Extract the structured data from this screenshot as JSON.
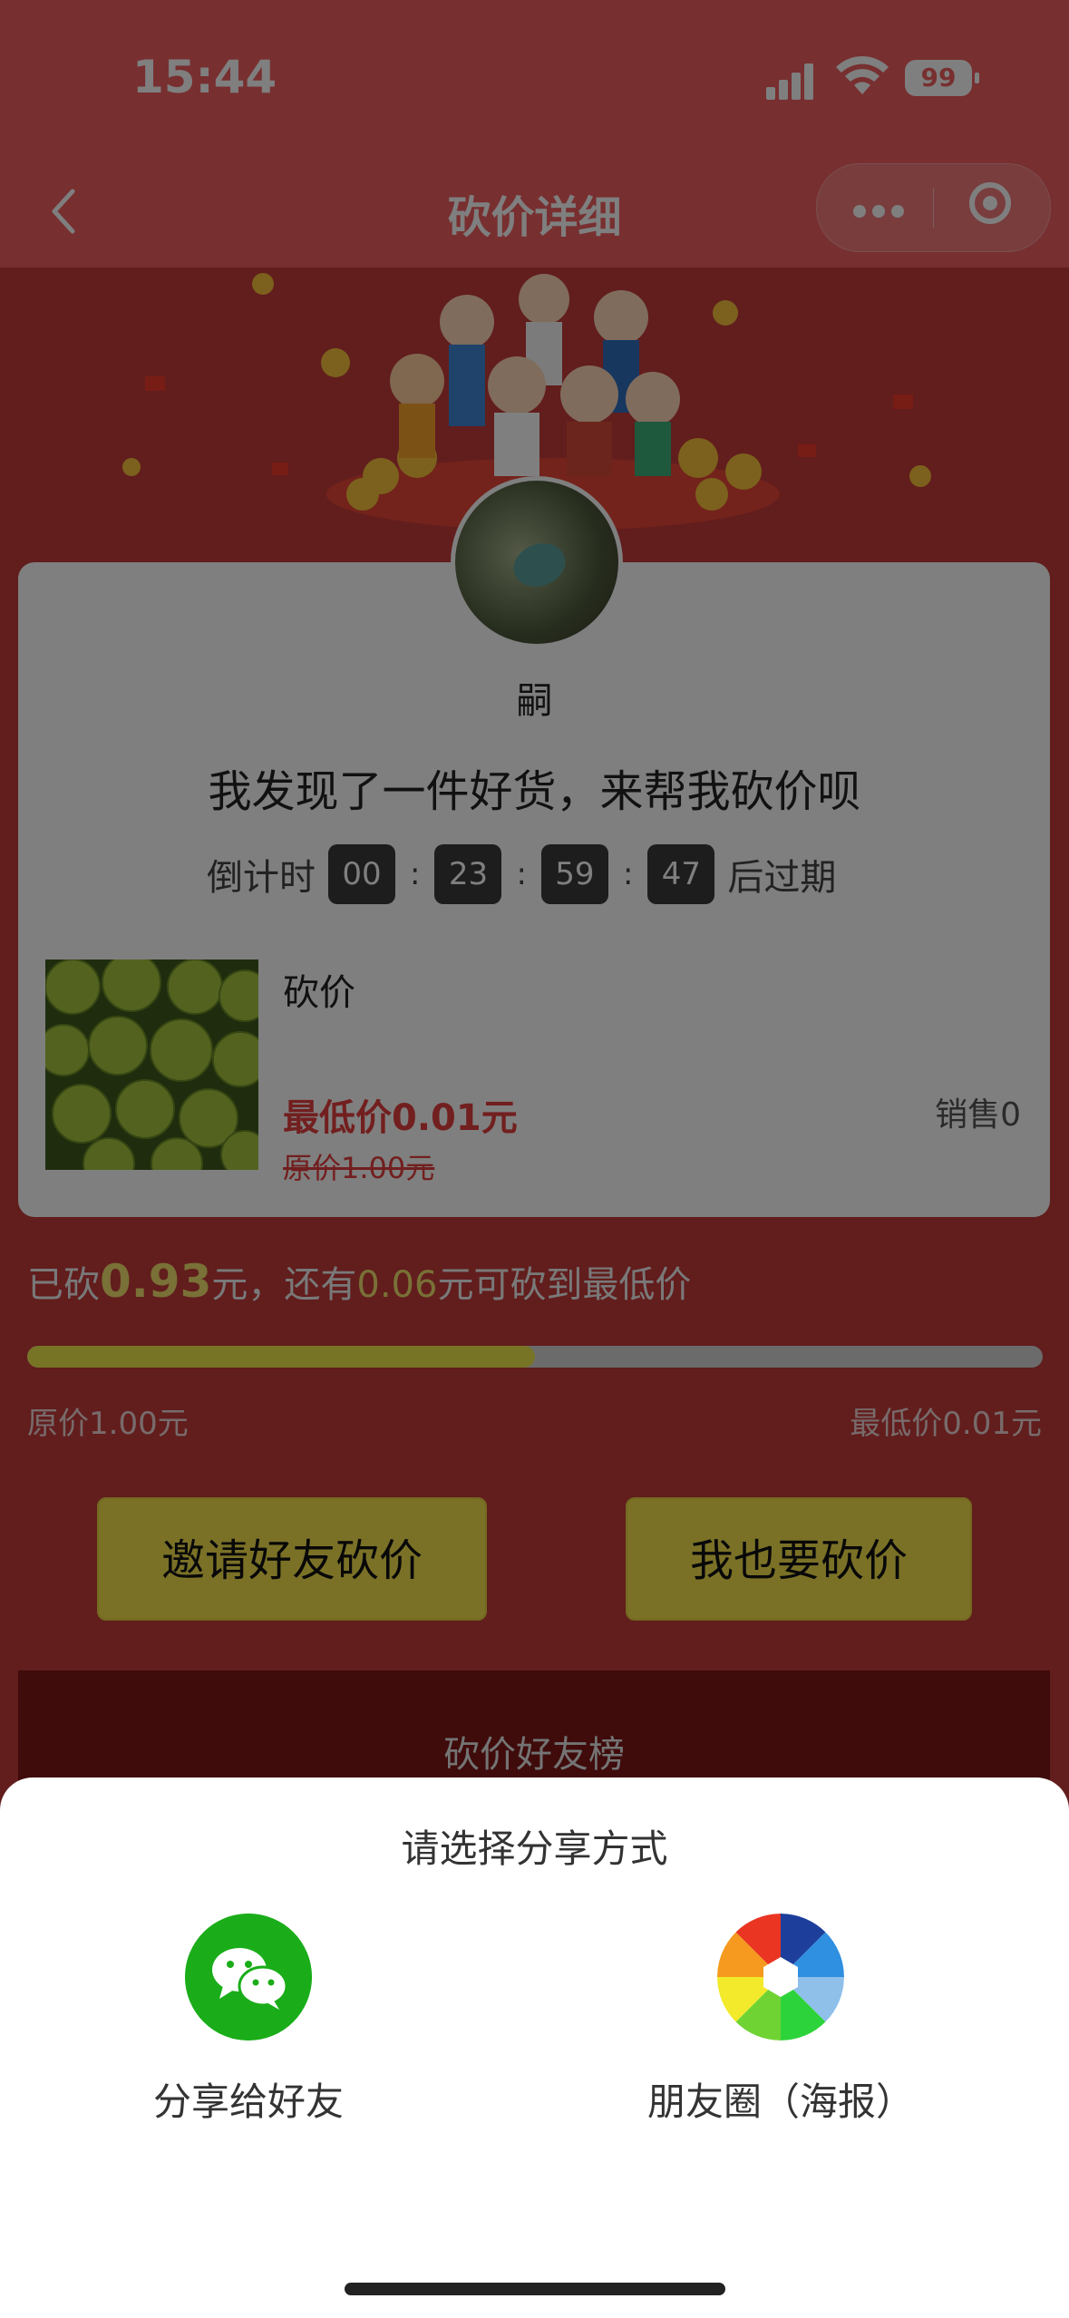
{
  "status_bar": {
    "time": "15:44",
    "battery": "99"
  },
  "nav": {
    "title": "砍价详细",
    "back_icon": "chevron-left-icon",
    "more_icon": "more-dots-icon",
    "close_icon": "target-icon"
  },
  "profile": {
    "username": "嗣",
    "slogan": "我发现了一件好货，来帮我砍价呗"
  },
  "countdown": {
    "prefix": "倒计时",
    "hours": "00",
    "minutes": "23",
    "seconds": "59",
    "ms": "47",
    "suffix": "后过期",
    "sep": ":"
  },
  "product": {
    "name": "砍价",
    "min_price": "最低价0.01元",
    "original_price": "原价1.00元",
    "sales": "销售0"
  },
  "cut": {
    "prefix": "已砍",
    "amount": "0.93",
    "mid1": "元，还有",
    "remaining": "0.06",
    "mid2": "元可砍到最低价",
    "progress": 0.5
  },
  "price_range": {
    "left": "原价1.00元",
    "right": "最低价0.01元"
  },
  "buttons": {
    "invite": "邀请好友砍价",
    "self": "我也要砍价"
  },
  "rank": {
    "title": "砍价好友榜"
  },
  "share_sheet": {
    "title": "请选择分享方式",
    "options": [
      {
        "label": "分享给好友",
        "icon": "wechat-icon"
      },
      {
        "label": "朋友圈（海报）",
        "icon": "moments-icon"
      }
    ]
  },
  "colors": {
    "header": "#f05f60",
    "page_bg": "#c43b3a",
    "accent_yellow": "#f4e24f",
    "price_red": "#e53e3e",
    "wechat_green": "#1aad19"
  }
}
